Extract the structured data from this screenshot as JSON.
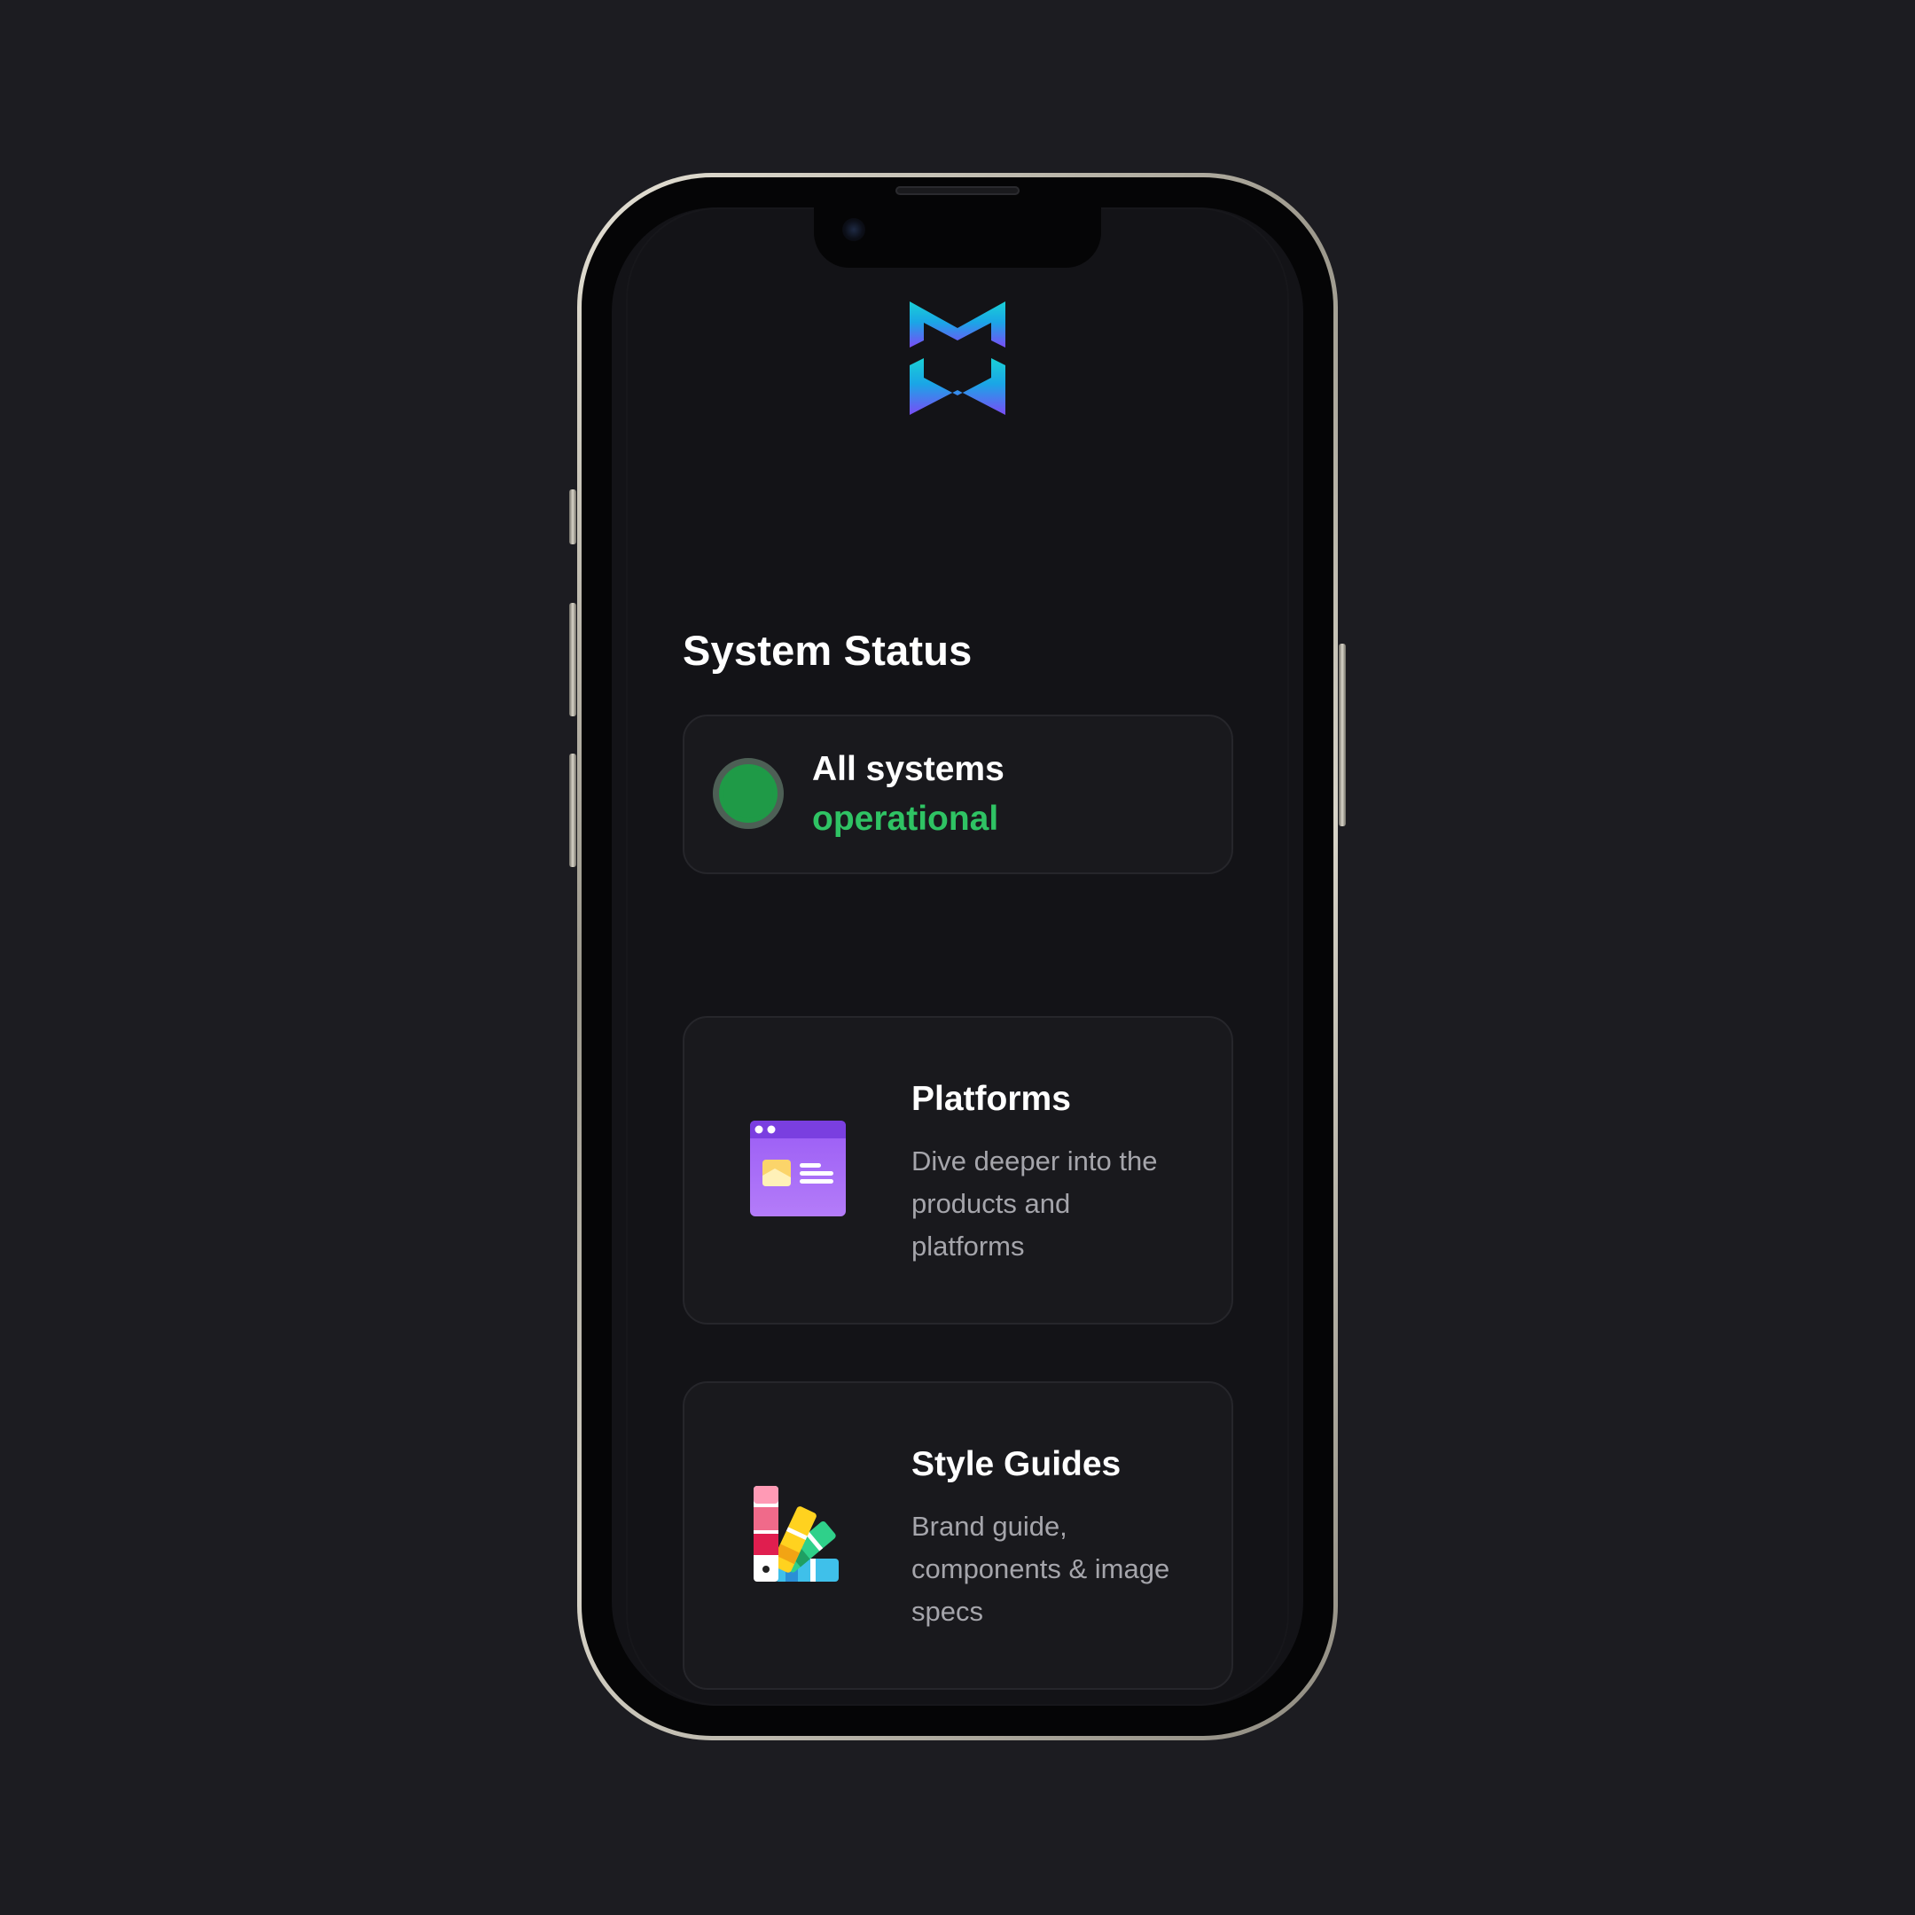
{
  "brand": {
    "logo_icon": "mw-gradient-logo-icon",
    "gradient_top": "#1ad0d6",
    "gradient_bottom": "#7a4cf7"
  },
  "status": {
    "heading": "System Status",
    "line1": "All systems",
    "line2": "operational",
    "indicator_color": "#1f9a47",
    "text_color": "#2fc364"
  },
  "cards": [
    {
      "icon": "browser-window-icon",
      "title": "Platforms",
      "description": "Dive deeper into the products and platforms"
    },
    {
      "icon": "color-swatch-fan-icon",
      "title": "Style Guides",
      "description": "Brand guide, components & image specs"
    }
  ]
}
